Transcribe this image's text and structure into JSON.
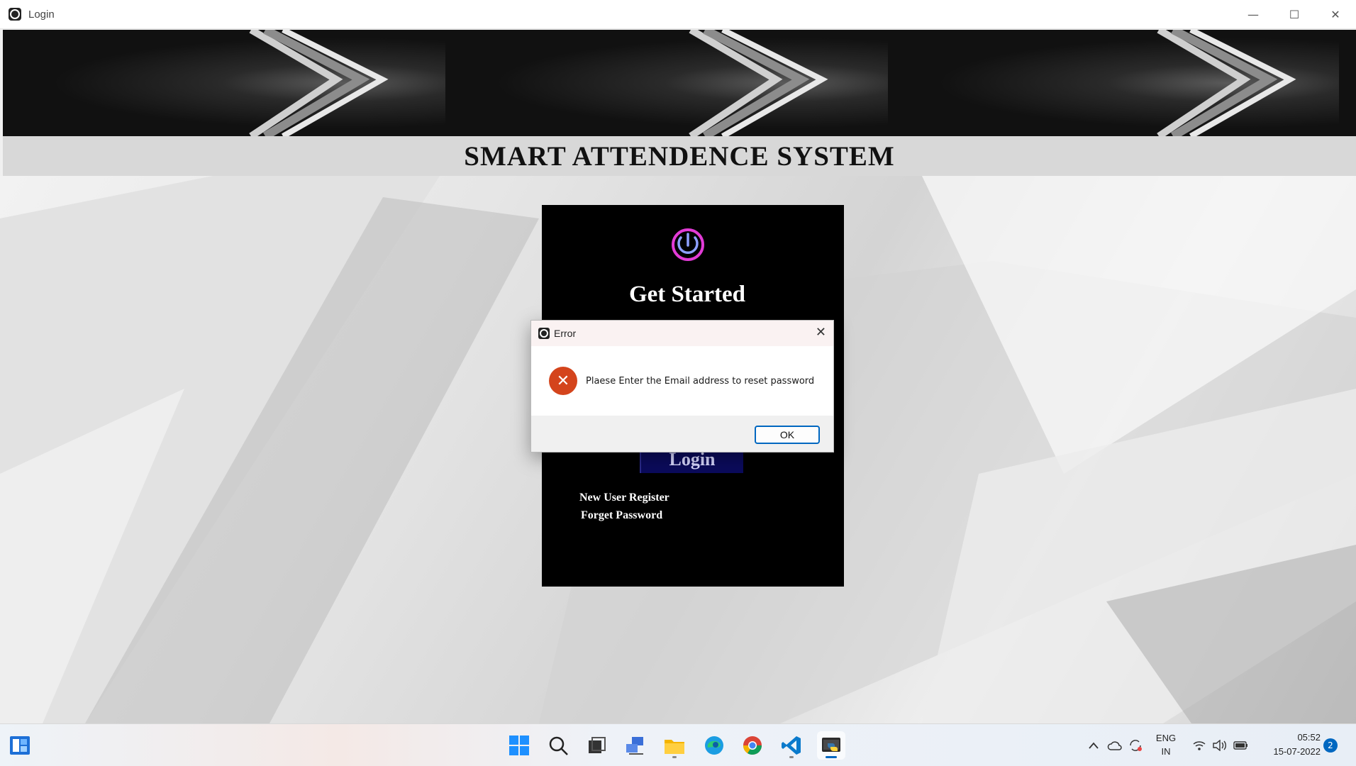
{
  "window": {
    "title": "Login",
    "minimize": "—",
    "maximize": "☐",
    "close": "✕"
  },
  "app": {
    "heading": "SMART ATTENDENCE SYSTEM"
  },
  "panel": {
    "title": "Get Started",
    "login_label": "Login",
    "register_link": "New User Register",
    "forget_link": "Forget Password"
  },
  "dialog": {
    "title": "Error",
    "message": "Plaese Enter the Email address to reset password",
    "ok_label": "OK",
    "close": "✕",
    "error_glyph": "✕"
  },
  "taskbar": {
    "icons": [
      "widgets-icon",
      "start-icon",
      "search-icon",
      "task-view-icon",
      "network-app-icon",
      "file-explorer-icon",
      "edge-icon",
      "chrome-icon",
      "vscode-icon",
      "python-icon"
    ],
    "language_top": "ENG",
    "language_bottom": "IN",
    "time": "05:52",
    "date": "15-07-2022",
    "notifications": "2"
  }
}
